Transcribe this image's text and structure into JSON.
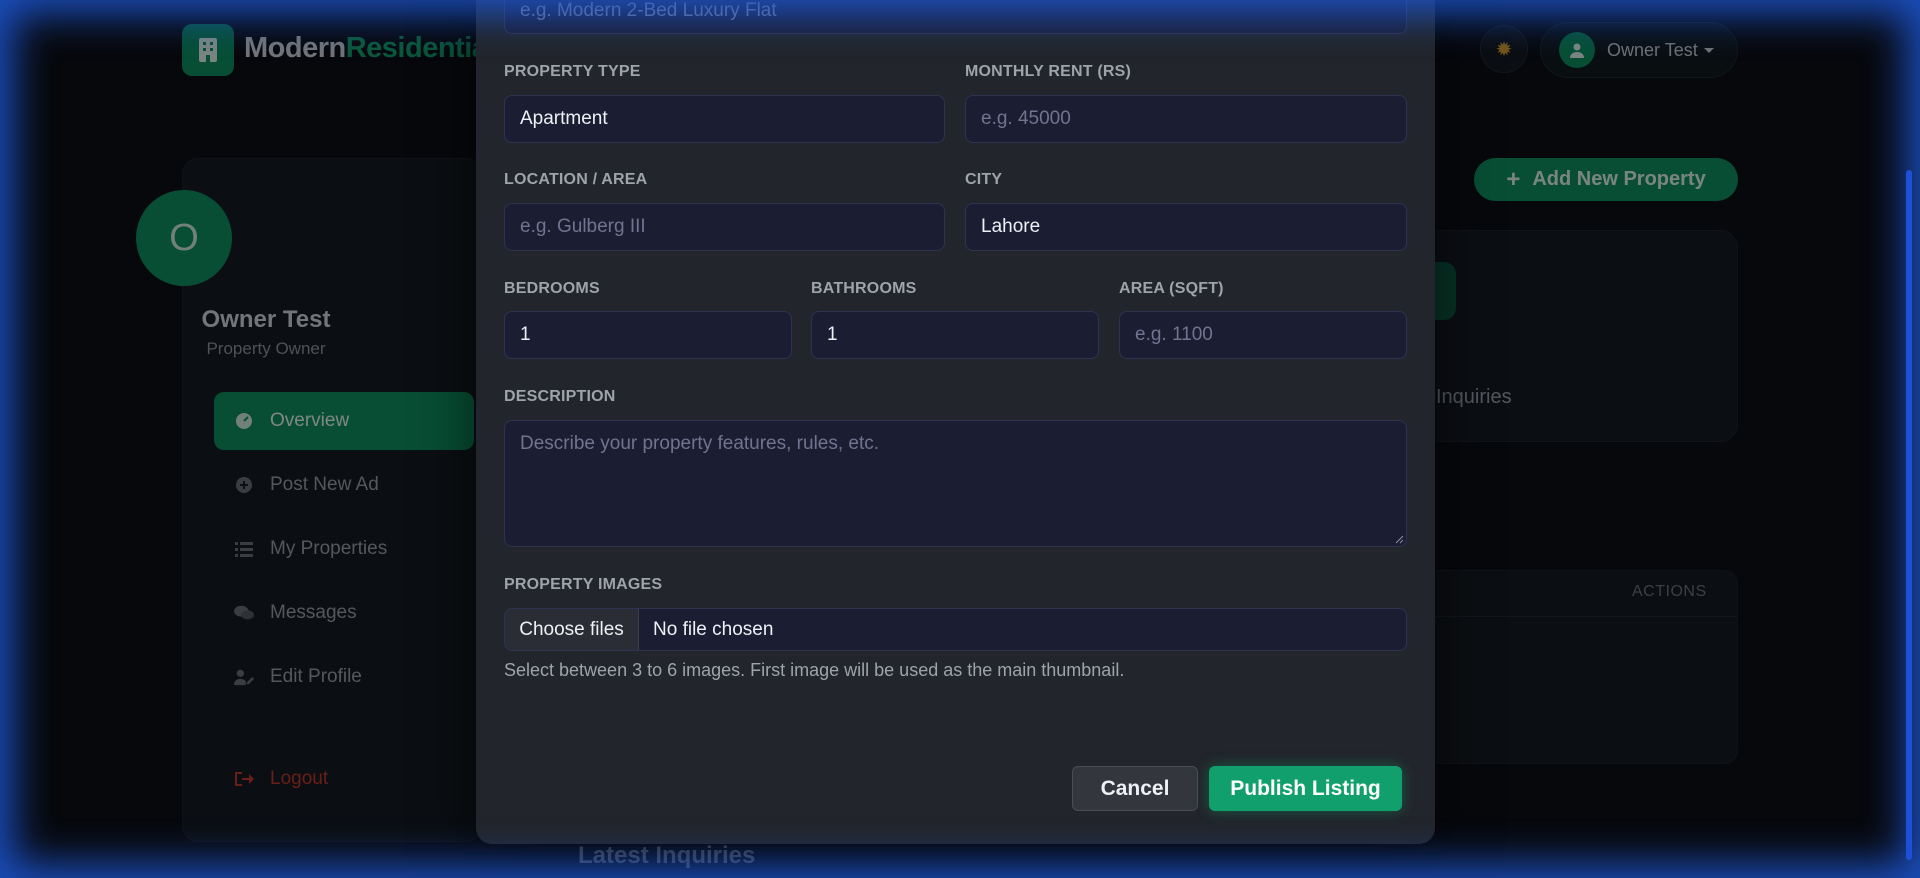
{
  "brand": {
    "part1": "Modern",
    "part2": "Residentia"
  },
  "header": {
    "user_name": "Owner Test"
  },
  "profile": {
    "initial": "O",
    "name": "Owner Test",
    "role": "Property Owner"
  },
  "sidebar": {
    "items": [
      {
        "label": "Overview"
      },
      {
        "label": "Post New Ad"
      },
      {
        "label": "My Properties"
      },
      {
        "label": "Messages"
      },
      {
        "label": "Edit Profile"
      }
    ],
    "logout": "Logout"
  },
  "main": {
    "add_button": "Add New Property",
    "inquiries_label": "Inquiries",
    "table_actions_header": "ACTIONS",
    "latest_title": "Latest Inquiries"
  },
  "modal": {
    "title_placeholder": "e.g. Modern 2-Bed Luxury Flat",
    "property_type": {
      "label": "PROPERTY TYPE",
      "value": "Apartment"
    },
    "monthly_rent": {
      "label": "MONTHLY RENT (RS)",
      "placeholder": "e.g. 45000"
    },
    "location": {
      "label": "LOCATION / AREA",
      "placeholder": "e.g. Gulberg III"
    },
    "city": {
      "label": "CITY",
      "value": "Lahore"
    },
    "bedrooms": {
      "label": "BEDROOMS",
      "value": "1"
    },
    "bathrooms": {
      "label": "BATHROOMS",
      "value": "1"
    },
    "area": {
      "label": "AREA (SQFT)",
      "placeholder": "e.g. 1100"
    },
    "description": {
      "label": "DESCRIPTION",
      "placeholder": "Describe your property features, rules, etc."
    },
    "images": {
      "label": "PROPERTY IMAGES",
      "choose_button": "Choose files",
      "status": "No file chosen",
      "helper": "Select between 3 to 6 images. First image will be used as the main thumbnail."
    },
    "cancel": "Cancel",
    "publish": "Publish Listing"
  },
  "colors": {
    "accent": "#11a06d",
    "frame": "#1e5adc",
    "danger": "#c0392b"
  }
}
